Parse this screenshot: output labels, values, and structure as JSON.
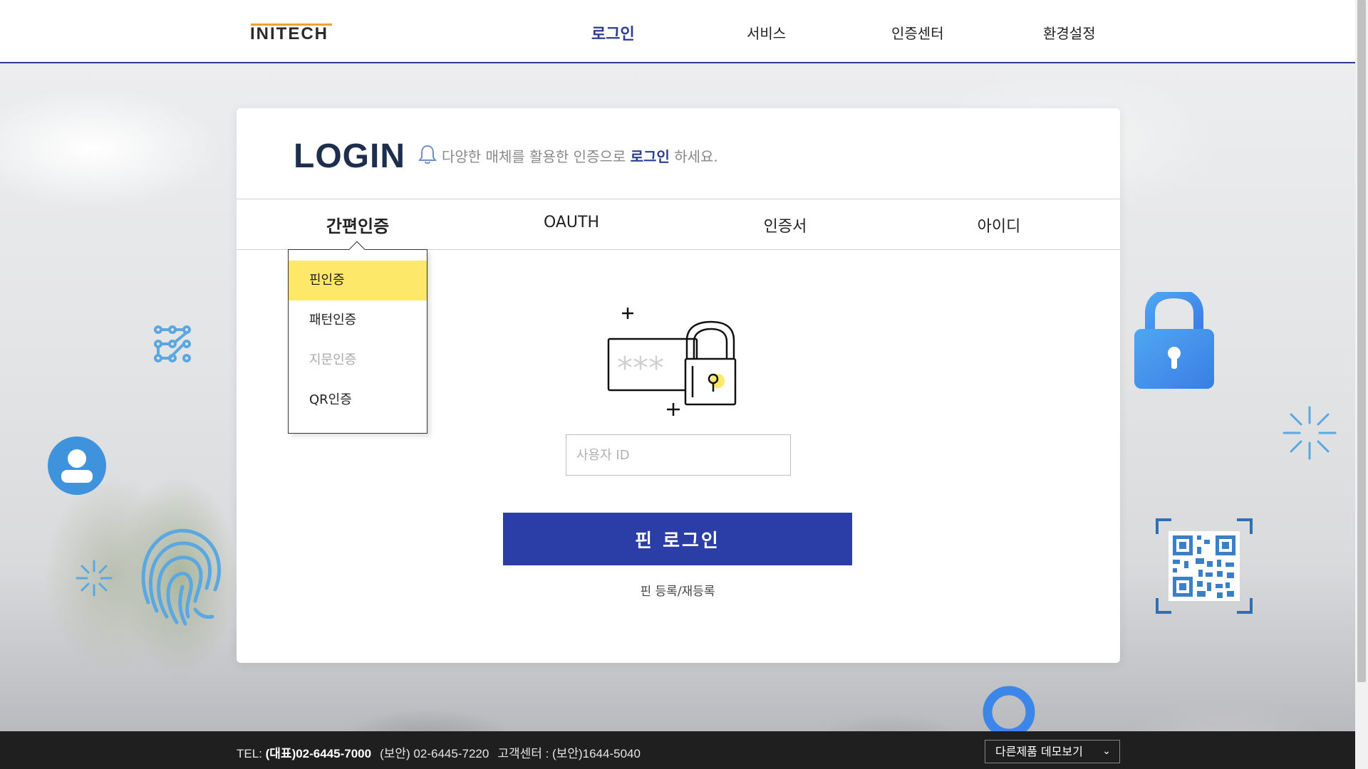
{
  "header": {
    "logo": "INITECH",
    "nav": [
      {
        "label": "로그인",
        "active": true
      },
      {
        "label": "서비스",
        "active": false
      },
      {
        "label": "인증센터",
        "active": false
      },
      {
        "label": "환경설정",
        "active": false
      }
    ]
  },
  "login": {
    "title": "LOGIN",
    "subtitle_pre": "다양한 매체를 활용한 인증으로 ",
    "subtitle_hl": "로그인",
    "subtitle_post": " 하세요.",
    "tabs": [
      {
        "label": "간편인증",
        "active": true
      },
      {
        "label": "OAUTH",
        "active": false
      },
      {
        "label": "인증서",
        "active": false
      },
      {
        "label": "아이디",
        "active": false
      }
    ],
    "dropdown": [
      {
        "label": "핀인증",
        "state": "selected"
      },
      {
        "label": "패턴인증",
        "state": "normal"
      },
      {
        "label": "지문인증",
        "state": "disabled"
      },
      {
        "label": "QR인증",
        "state": "normal"
      }
    ],
    "user_id_placeholder": "사용자 ID",
    "user_id_value": "",
    "login_button": "핀 로그인",
    "pin_register_link": "핀 등록/재등록"
  },
  "footer": {
    "tel_label": "TEL: ",
    "tel_main": "(대표)02-6445-7000",
    "tel_security": "(보안) 02-6445-7220",
    "support": "고객센터 : (보안)1644-5040",
    "demo_select": "다른제품 데모보기"
  },
  "colors": {
    "brand": "#2b3d8f",
    "button": "#2b3ea8",
    "highlight": "#fde869",
    "icon_blue": "#5ba8e0"
  },
  "icons": [
    "bell-icon",
    "pin-lock-icon",
    "pattern-icon",
    "user-icon",
    "fingerprint-icon",
    "sparkle-icon",
    "lock-icon",
    "qr-code-icon",
    "ring-icon",
    "chevron-down-icon"
  ]
}
